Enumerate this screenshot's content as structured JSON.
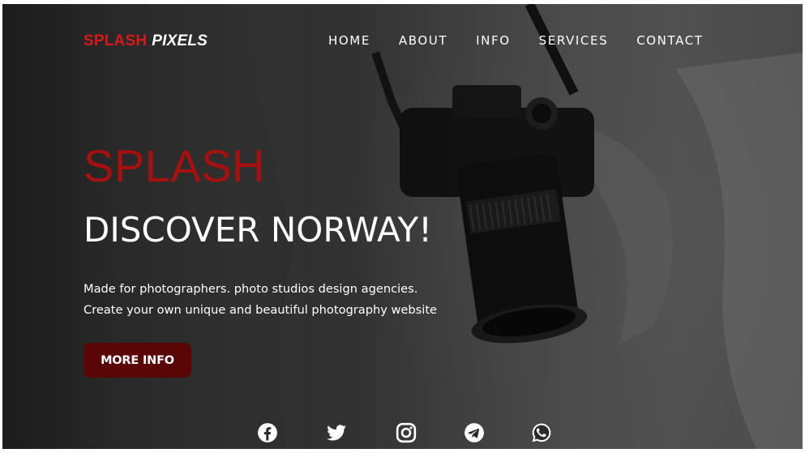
{
  "brand": {
    "name_part1": "SPLASH",
    "name_part2": "PIXELS",
    "colors": {
      "accent_red": "#d51a1a",
      "hero_red": "#a80f0f",
      "button_bg": "#5a0606"
    }
  },
  "nav": {
    "items": [
      {
        "label": "HOME"
      },
      {
        "label": "ABOUT"
      },
      {
        "label": "INFO"
      },
      {
        "label": "SERVICES"
      },
      {
        "label": "CONTACT"
      }
    ]
  },
  "hero": {
    "kicker": "SPLASH",
    "title": "DISCOVER NORWAY!",
    "description_line1": "Made for photographers. photo studios design agencies.",
    "description_line2": "Create your own unique and beautiful photography website",
    "cta_label": "MORE INFO"
  },
  "socials": [
    {
      "icon": "facebook-icon"
    },
    {
      "icon": "twitter-icon"
    },
    {
      "icon": "instagram-icon"
    },
    {
      "icon": "telegram-icon"
    },
    {
      "icon": "whatsapp-icon"
    }
  ]
}
